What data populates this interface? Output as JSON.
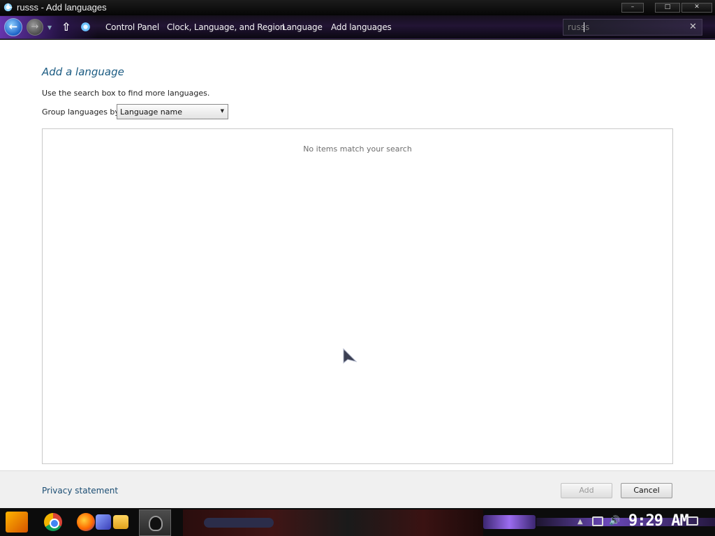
{
  "window": {
    "title": "russs - Add languages",
    "min_glyph": "–",
    "max_glyph": "□",
    "close_glyph": "✕"
  },
  "breadcrumb": {
    "items": [
      "Control Panel",
      "Clock, Language, and Region",
      "Language",
      "Add languages"
    ]
  },
  "search": {
    "value": "russs",
    "clear_glyph": "✕"
  },
  "page": {
    "heading": "Add a language",
    "hint": "Use the search box to find more languages.",
    "group_by_label": "Group languages by:",
    "group_by_value": "Language name",
    "empty_message": "No items match your search"
  },
  "footer": {
    "privacy_label": "Privacy statement",
    "add_label": "Add",
    "cancel_label": "Cancel"
  },
  "taskbar": {
    "clock": "9:29 AM"
  },
  "colors": {
    "heading": "#1b5b82",
    "link": "#1b4d73",
    "accent": "#7a3fd0"
  }
}
